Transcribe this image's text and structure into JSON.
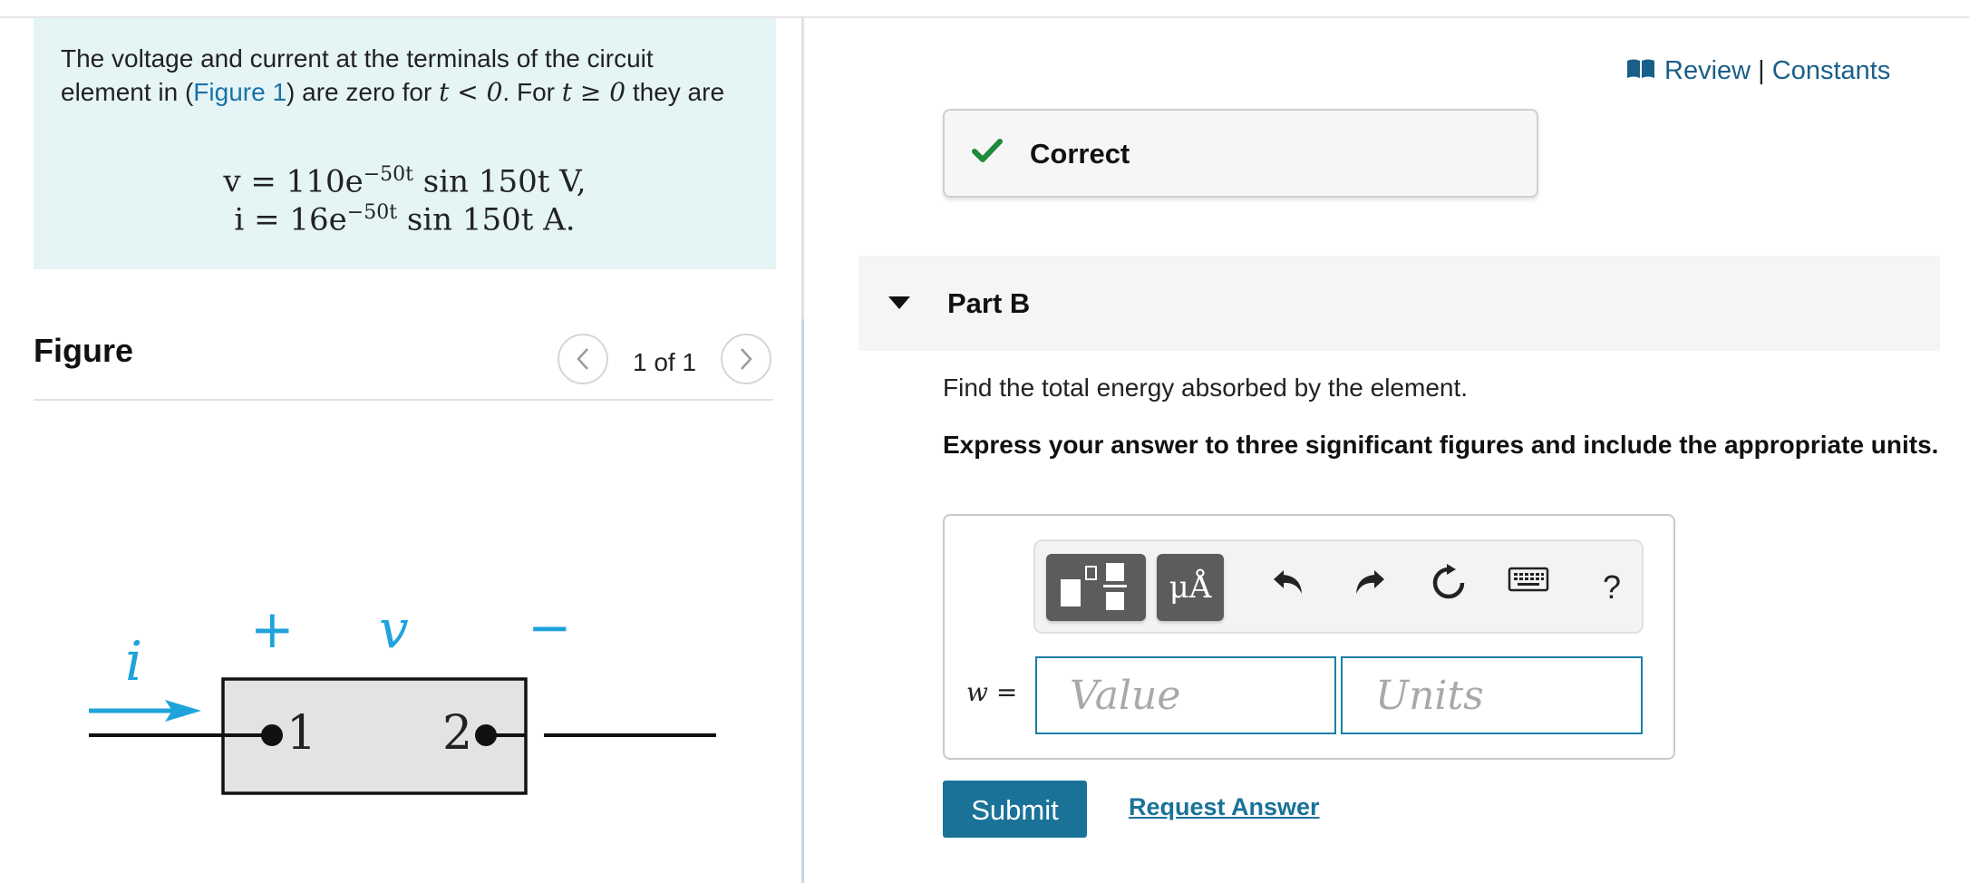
{
  "problem": {
    "text_before_link": "The voltage and current at the terminals of the circuit element in (",
    "figure_link": "Figure 1",
    "text_after_link": ") are zero for ",
    "cond1": "t < 0",
    "text_mid": ". For ",
    "cond2": "t ≥ 0",
    "text_end": " they are",
    "equation_v": {
      "lhs": "v = 110e",
      "exp": "−50t",
      "rhs": " sin 150t V,"
    },
    "equation_i": {
      "lhs": "i = 16e",
      "exp": "−50t",
      "rhs": " sin 150t A."
    }
  },
  "figure": {
    "title": "Figure",
    "page_counter": "1 of 1",
    "prev_icon": "chevron-left-icon",
    "next_icon": "chevron-right-icon",
    "circuit": {
      "current_label": "i",
      "plus_label": "+",
      "voltage_label": "v",
      "minus_label": "−",
      "terminal1": "1",
      "terminal2": "2"
    }
  },
  "header": {
    "review_icon": "book-icon",
    "review": "Review",
    "separator": "|",
    "constants": "Constants"
  },
  "feedback": {
    "icon": "checkmark-icon",
    "label": "Correct",
    "color": "#1e8a3c"
  },
  "part": {
    "caret_icon": "caret-down-icon",
    "title": "Part B",
    "question": "Find the total energy absorbed by the element.",
    "instruction": "Express your answer to three significant figures and include the appropriate units."
  },
  "answer": {
    "toolbar": {
      "templates_icon": "templates-icon",
      "units_label": "μÅ",
      "undo_icon": "undo-icon",
      "redo_icon": "redo-icon",
      "reset_icon": "reset-icon",
      "keyboard_icon": "keyboard-icon",
      "help_label": "?"
    },
    "variable_label": "w",
    "equals": " =",
    "value_placeholder": "Value",
    "value": "",
    "units_placeholder": "Units",
    "units": ""
  },
  "actions": {
    "submit": "Submit",
    "request_answer": "Request Answer"
  },
  "colors": {
    "accent": "#1a7298",
    "link": "#1a73a8",
    "figure_blue": "#1ea3db",
    "problem_bg": "#e5f4f5"
  }
}
